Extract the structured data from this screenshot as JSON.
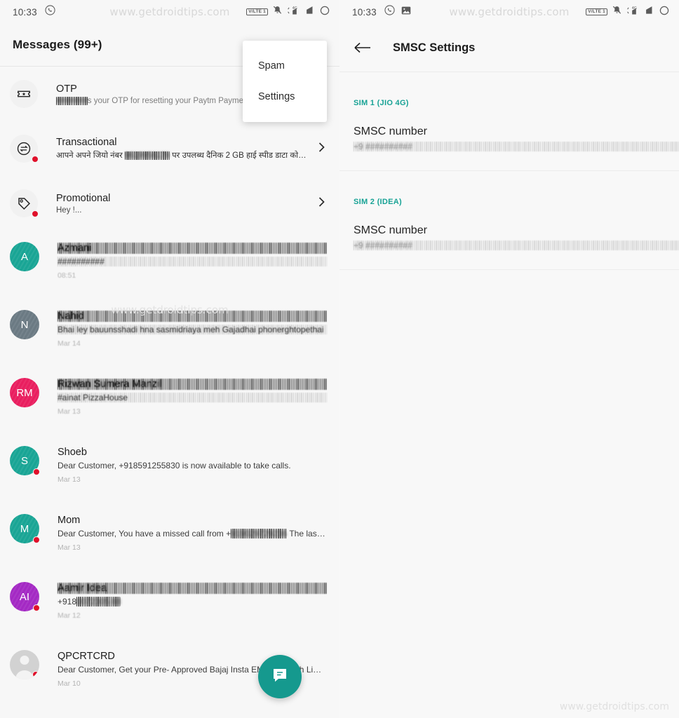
{
  "left_panel": {
    "statusbar": {
      "time": "10:33",
      "left_icons": [
        "whatsapp-icon"
      ],
      "watermark": "www.getdroidtips.com",
      "right_icons": [
        "volte-badge",
        "notifications-muted-icon",
        "signal-4g-icon",
        "signal-icon",
        "battery-icon"
      ],
      "volte_label": "V/LTE 1",
      "network_label": "4G"
    },
    "header": {
      "title": "Messages (99+)"
    },
    "popup_menu": {
      "items": [
        {
          "label": "Spam"
        },
        {
          "label": "Settings"
        }
      ]
    },
    "categories": [
      {
        "icon": "ticket-star-icon",
        "title": "OTP",
        "snippet_redacted": "#######",
        "snippet": "s your OTP for resetting your Paytm Payments Bank UPI pin. ...",
        "has_badge": false
      },
      {
        "icon": "transaction-arrows-icon",
        "title": "Transactional",
        "snippet_pre": "आपने अपने जियो नंबर ",
        "snippet_redacted": "9619956178",
        "snippet_post": " पर उपलब्ध दैनिक 2 GB  हाई स्पीड डाटा कोटा ...",
        "has_badge": true
      },
      {
        "icon": "price-tag-icon",
        "title": "Promotional",
        "snippet": "Hey !...",
        "has_badge": true
      }
    ],
    "conversations": [
      {
        "initials": "A",
        "avatar_color": "#19a595",
        "name": "Azmani",
        "name_redacted": true,
        "snippet": "##########",
        "snippet_redacted": true,
        "date": "08:51",
        "has_badge": false
      },
      {
        "initials": "N",
        "avatar_color": "#6b7a83",
        "name": "Nahid",
        "name_redacted": true,
        "snippet": "Bhai ley bauunsshadi hna sasmidriaya meh Gajadhai phonerghtopethai",
        "snippet_redacted": true,
        "date": "Mar 14",
        "has_badge": false
      },
      {
        "initials": "RM",
        "avatar_color": "#e91e5f",
        "name": "Rizwan Sumera Manzil",
        "name_redacted": true,
        "snippet": "#ainat PizzaHouse",
        "snippet_redacted": true,
        "date": "Mar 13",
        "has_badge": false
      },
      {
        "initials": "S",
        "avatar_color": "#19a595",
        "name": "Shoeb",
        "name_redacted": false,
        "snippet": "Dear Customer, +918591255830 is now available to take calls.",
        "snippet_redacted": false,
        "date": "Mar 13",
        "has_badge": true
      },
      {
        "initials": "M",
        "avatar_color": "#19a595",
        "name": "Mom",
        "name_redacted": false,
        "snippet_pre": "Dear Customer, You have a missed call from +",
        "snippet_redacted_part": "919029729236",
        "snippet_post": " The last miss...",
        "snippet_redacted": false,
        "date": "Mar 13",
        "has_badge": true
      },
      {
        "initials": "AI",
        "avatar_color": "#a429c4",
        "name": "Aamir Idea",
        "name_redacted": true,
        "snippet_pre": "+918",
        "snippet_redacted_part": "0072305 88",
        "snippet_redacted": true,
        "date": "Mar 12",
        "has_badge": true
      },
      {
        "initials": "",
        "avatar_color": "#d2d2d2",
        "avatar_type": "person-placeholder",
        "name": "QPCRTCRD",
        "name_redacted": false,
        "snippet": "Dear Customer, Get your Pre- Approved Bajaj Insta EMI Card with Limit up ...",
        "snippet_redacted": false,
        "date": "Mar 10",
        "has_badge": true
      }
    ],
    "fab": {
      "icon": "new-message-icon",
      "color": "#15998e"
    },
    "watermark_center": "www.getdroidtips.com"
  },
  "right_panel": {
    "statusbar": {
      "time": "10:33",
      "left_icons": [
        "whatsapp-icon",
        "image-icon"
      ],
      "watermark": "www.getdroidtips.com",
      "volte_label": "V/LTE 1",
      "network_label": "4G"
    },
    "header": {
      "title": "SMSC Settings",
      "back_icon": "back-arrow-icon"
    },
    "sections": [
      {
        "sim_label": "SIM 1 (JIO 4G)",
        "item_title": "SMSC number",
        "item_value": "+9 ##########"
      },
      {
        "sim_label": "SIM 2 (IDEA)",
        "item_title": "SMSC number",
        "item_value": "+9 ##########"
      }
    ],
    "watermark_bottom_right": "www.getdroidtips.com"
  },
  "theme": {
    "accent_teal": "#17a295",
    "badge_red": "#e0112b",
    "background": "#f7f7f7"
  }
}
